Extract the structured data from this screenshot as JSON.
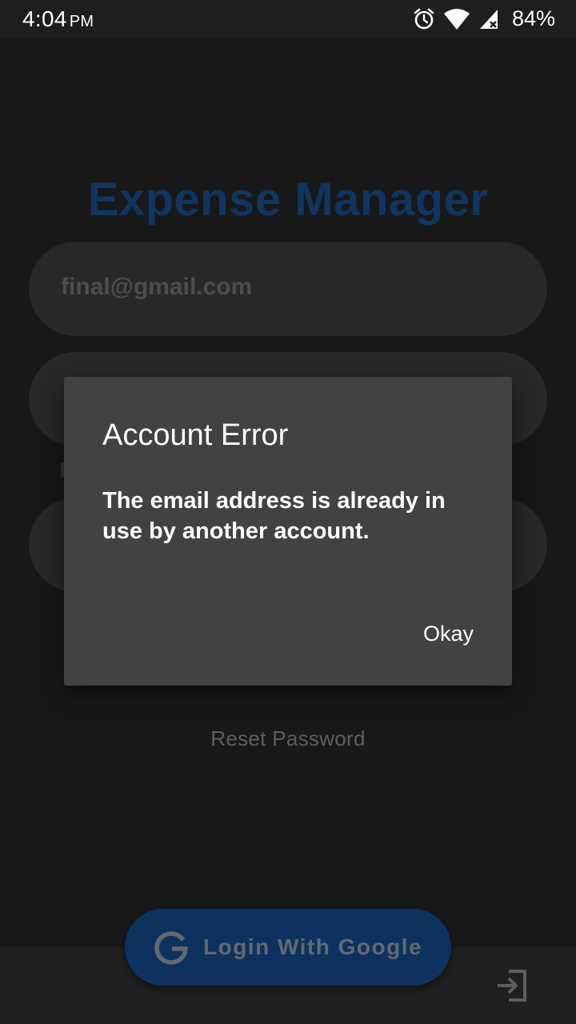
{
  "status_bar": {
    "time": "4:04",
    "ampm": "PM",
    "battery": "84%",
    "icons": [
      "alarm-icon",
      "wifi-icon",
      "cell-signal-icon"
    ]
  },
  "app": {
    "title": "Expense Manager",
    "email_value": "final@gmail.com",
    "reset_password_label": "Reset Password",
    "google_button_label": "Login With Google",
    "colors": {
      "accent": "#1f6bc1",
      "google_button": "#1a65bf"
    }
  },
  "dialog": {
    "title": "Account Error",
    "message": "The email address is already in use by another account.",
    "ok_label": "Okay"
  }
}
